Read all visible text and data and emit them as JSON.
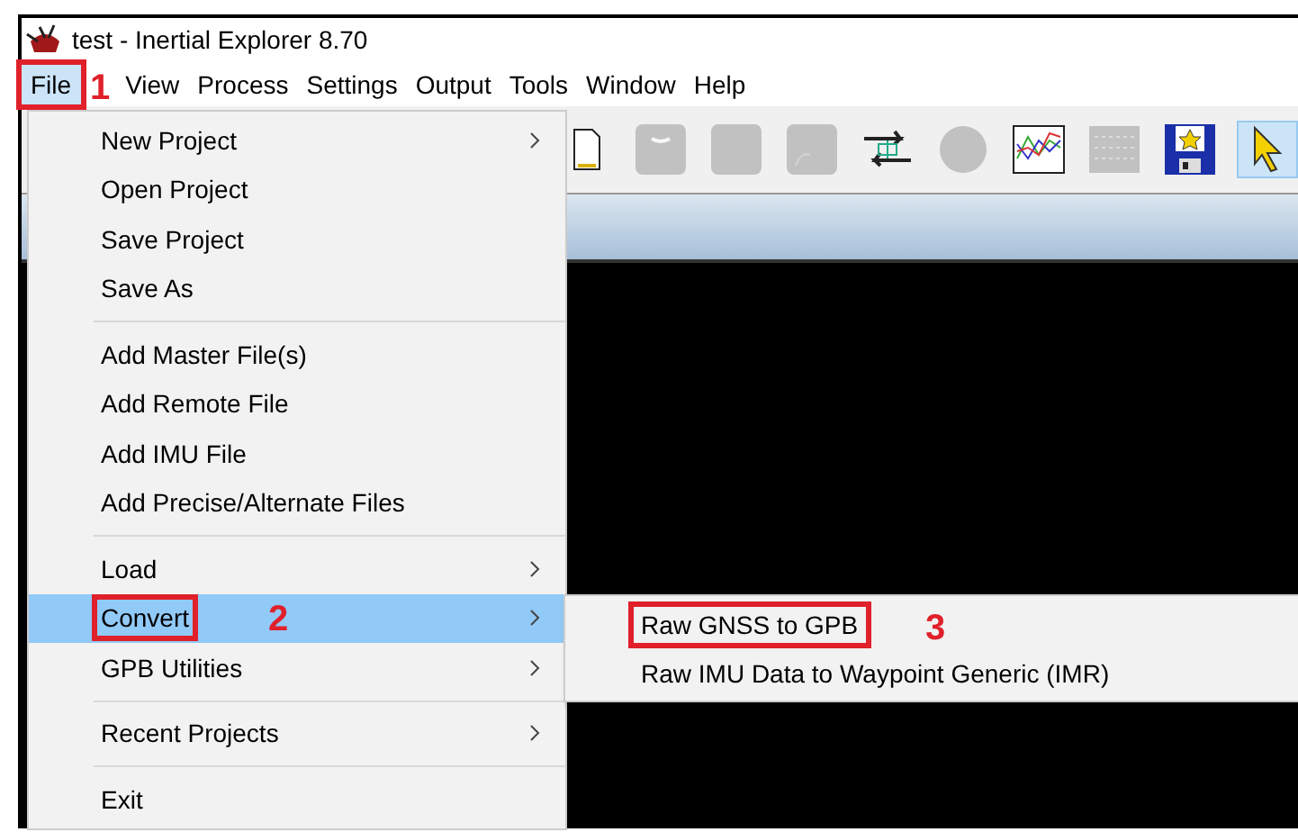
{
  "window": {
    "title": "test - Inertial Explorer 8.70"
  },
  "menubar": [
    {
      "label": "File",
      "selected": true,
      "marker": "1"
    },
    {
      "label": "View",
      "selected": false
    },
    {
      "label": "Process",
      "selected": false
    },
    {
      "label": "Settings",
      "selected": false
    },
    {
      "label": "Output",
      "selected": false
    },
    {
      "label": "Tools",
      "selected": false
    },
    {
      "label": "Window",
      "selected": false
    },
    {
      "label": "Help",
      "selected": false
    }
  ],
  "toolbar": [
    {
      "kind": "document",
      "disabled": false,
      "selected": false
    },
    {
      "kind": "bar",
      "disabled": true,
      "selected": false
    },
    {
      "kind": "square",
      "disabled": true,
      "selected": false
    },
    {
      "kind": "curve",
      "disabled": true,
      "selected": false
    },
    {
      "kind": "arrows",
      "disabled": false,
      "selected": false
    },
    {
      "kind": "circle",
      "disabled": true,
      "selected": false
    },
    {
      "kind": "chart",
      "disabled": false,
      "selected": false
    },
    {
      "kind": "grid",
      "disabled": true,
      "selected": false
    },
    {
      "kind": "save",
      "disabled": false,
      "selected": false
    },
    {
      "kind": "pointer",
      "disabled": false,
      "selected": true
    }
  ],
  "file_menu": [
    {
      "kind": "item",
      "label": "New Project",
      "submenu": true,
      "selected": false
    },
    {
      "kind": "item",
      "label": "Open Project",
      "submenu": false,
      "selected": false
    },
    {
      "kind": "item",
      "label": "Save Project",
      "submenu": false,
      "selected": false
    },
    {
      "kind": "item",
      "label": "Save As",
      "submenu": false,
      "selected": false
    },
    {
      "kind": "separator"
    },
    {
      "kind": "item",
      "label": "Add Master File(s)",
      "submenu": false,
      "selected": false
    },
    {
      "kind": "item",
      "label": "Add Remote File",
      "submenu": false,
      "selected": false
    },
    {
      "kind": "item",
      "label": "Add IMU File",
      "submenu": false,
      "selected": false
    },
    {
      "kind": "item",
      "label": "Add Precise/Alternate Files",
      "submenu": false,
      "selected": false
    },
    {
      "kind": "separator"
    },
    {
      "kind": "item",
      "label": "Load",
      "submenu": true,
      "selected": false
    },
    {
      "kind": "item",
      "label": "Convert",
      "submenu": true,
      "selected": true,
      "marker": "2"
    },
    {
      "kind": "item",
      "label": "GPB Utilities",
      "submenu": true,
      "selected": false
    },
    {
      "kind": "separator"
    },
    {
      "kind": "item",
      "label": "Recent Projects",
      "submenu": true,
      "selected": false
    },
    {
      "kind": "separator"
    },
    {
      "kind": "item",
      "label": "Exit",
      "submenu": false,
      "selected": false
    }
  ],
  "convert_submenu": [
    {
      "label": "Raw GNSS to GPB",
      "marker": "3"
    },
    {
      "label": "Raw IMU Data to Waypoint Generic (IMR)"
    }
  ]
}
